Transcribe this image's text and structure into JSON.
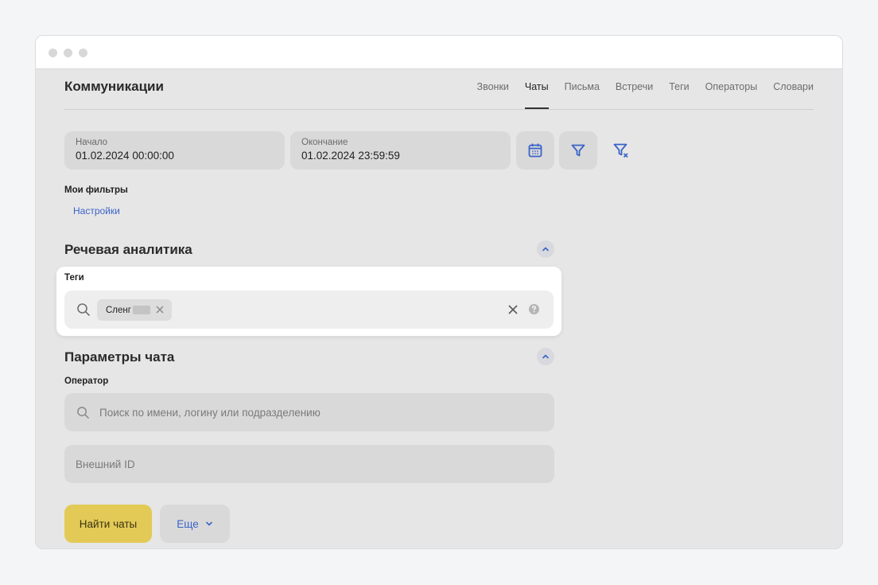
{
  "header": {
    "title": "Коммуникации",
    "tabs": [
      {
        "label": "Звонки",
        "active": false
      },
      {
        "label": "Чаты",
        "active": true
      },
      {
        "label": "Письма",
        "active": false
      },
      {
        "label": "Встречи",
        "active": false
      },
      {
        "label": "Теги",
        "active": false
      },
      {
        "label": "Операторы",
        "active": false
      },
      {
        "label": "Словари",
        "active": false
      }
    ]
  },
  "filters": {
    "start": {
      "label": "Начало",
      "value": "01.02.2024 00:00:00"
    },
    "end": {
      "label": "Окончание",
      "value": "01.02.2024 23:59:59"
    },
    "icons": [
      "calendar-icon",
      "filter-icon",
      "filter-clear-icon"
    ],
    "my_filters_label": "Мои фильтры",
    "settings_link": "Настройки"
  },
  "speech_analytics": {
    "title": "Речевая аналитика",
    "tags_label": "Теги",
    "tag_chip": "Сленг"
  },
  "chat_params": {
    "title": "Параметры чата",
    "operator_label": "Оператор",
    "operator_placeholder": "Поиск по имени, логину или подразделению",
    "external_id_placeholder": "Внешний ID"
  },
  "actions": {
    "find_label": "Найти чаты",
    "more_label": "Еще"
  },
  "colors": {
    "accent_blue": "#3a63c9",
    "primary_yellow": "#e3ca57"
  }
}
